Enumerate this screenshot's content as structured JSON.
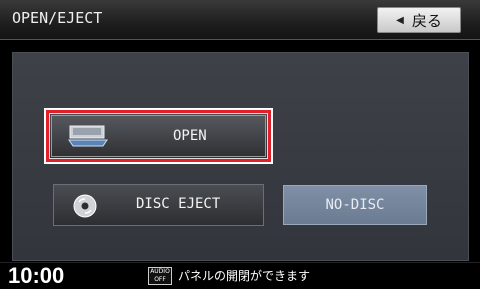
{
  "header": {
    "title": "OPEN/EJECT",
    "back_label": "戻る"
  },
  "buttons": {
    "open": "OPEN",
    "disc_eject": "DISC EJECT",
    "no_disc": "NO-DISC"
  },
  "footer": {
    "clock": "10:00",
    "audio_off_top": "AUDIO",
    "audio_off_bottom": "OFF",
    "message": "パネルの開閉ができます"
  },
  "colors": {
    "highlight": "#e0202a",
    "nodisc_bg": "#7f8fa6"
  }
}
